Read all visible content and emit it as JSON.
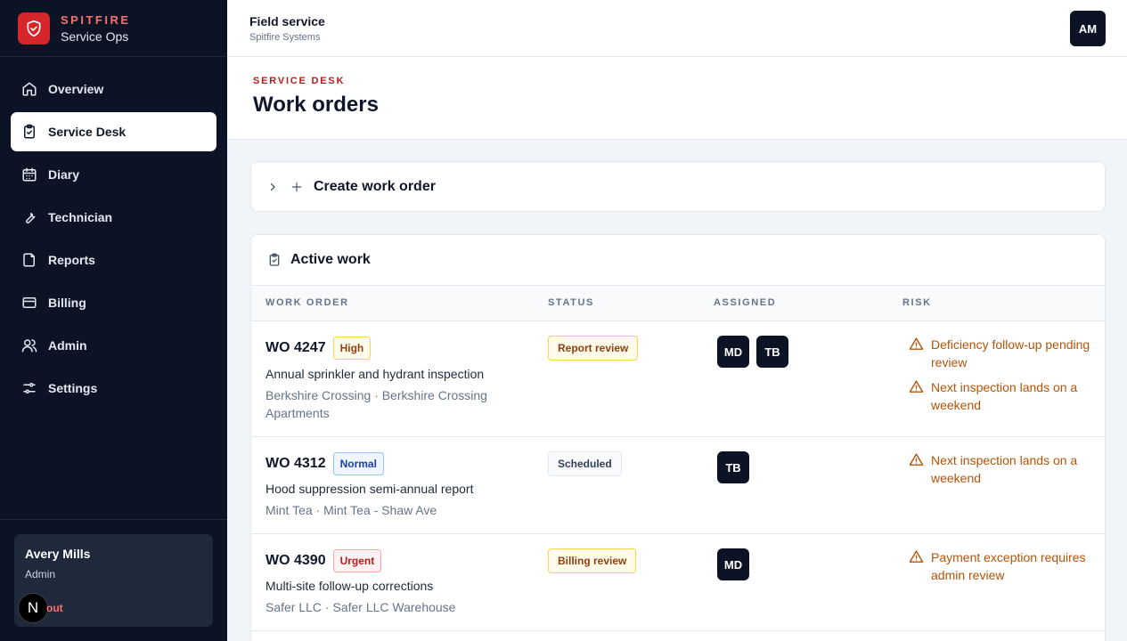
{
  "brand": {
    "name": "SPITFIRE",
    "subtitle": "Service Ops"
  },
  "sidebar": {
    "items": [
      {
        "label": "Overview",
        "icon": "home-icon"
      },
      {
        "label": "Service Desk",
        "icon": "clipboard-check-icon",
        "active": true
      },
      {
        "label": "Diary",
        "icon": "calendar-icon"
      },
      {
        "label": "Technician",
        "icon": "wrench-icon"
      },
      {
        "label": "Reports",
        "icon": "file-icon"
      },
      {
        "label": "Billing",
        "icon": "credit-card-icon"
      },
      {
        "label": "Admin",
        "icon": "users-icon"
      },
      {
        "label": "Settings",
        "icon": "sliders-icon"
      }
    ],
    "user": {
      "name": "Avery Mills",
      "role": "Admin",
      "signout_label": "out",
      "badge": "N"
    }
  },
  "topbar": {
    "title": "Field service",
    "subtitle": "Spitfire Systems",
    "avatar": "AM"
  },
  "page": {
    "eyebrow": "SERVICE DESK",
    "title": "Work orders"
  },
  "create": {
    "label": "Create work order"
  },
  "active": {
    "title": "Active work",
    "columns": [
      "WORK ORDER",
      "STATUS",
      "ASSIGNED",
      "RISK"
    ],
    "rows": [
      {
        "id": "WO 4247",
        "priority": "High",
        "priority_level": "high",
        "description": "Annual sprinkler and hydrant inspection",
        "location": "Berkshire Crossing · Berkshire Crossing Apartments",
        "status": "Report review",
        "status_tone": "amber",
        "assigned": [
          "MD",
          "TB"
        ],
        "risks": [
          "Deficiency follow-up pending review",
          "Next inspection lands on a weekend"
        ]
      },
      {
        "id": "WO 4312",
        "priority": "Normal",
        "priority_level": "normal",
        "description": "Hood suppression semi-annual report",
        "location": "Mint Tea · Mint Tea - Shaw Ave",
        "status": "Scheduled",
        "status_tone": "gray",
        "assigned": [
          "TB"
        ],
        "risks": [
          "Next inspection lands on a weekend"
        ]
      },
      {
        "id": "WO 4390",
        "priority": "Urgent",
        "priority_level": "urgent",
        "description": "Multi-site follow-up corrections",
        "location": "Safer LLC · Safer LLC Warehouse",
        "status": "Billing review",
        "status_tone": "amber",
        "assigned": [
          "MD"
        ],
        "risks": [
          "Payment exception requires admin review"
        ]
      }
    ]
  },
  "colors": {
    "sidebar_bg": "#0b1324",
    "brand_red": "#d7262b",
    "risk_amber": "#b45309",
    "eyebrow_red": "#b91c1c"
  }
}
